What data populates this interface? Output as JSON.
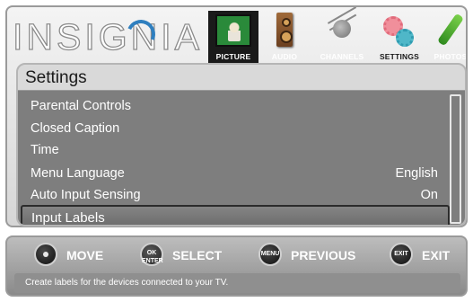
{
  "brand": {
    "logo_text": "INSIGNIA"
  },
  "tabs": [
    {
      "label": "PICTURE",
      "icon": "tv-icon"
    },
    {
      "label": "AUDIO",
      "icon": "speaker-icon"
    },
    {
      "label": "CHANNELS",
      "icon": "antenna-icon"
    },
    {
      "label": "SETTINGS",
      "icon": "gears-icon",
      "active": true
    },
    {
      "label": "PHOTOS",
      "icon": "photo-icon"
    }
  ],
  "settings": {
    "title": "Settings",
    "items": [
      {
        "label": "Parental Controls",
        "value": ""
      },
      {
        "label": "Closed Caption",
        "value": ""
      },
      {
        "label": "Time",
        "value": ""
      },
      {
        "label": "Menu Language",
        "value": "English"
      },
      {
        "label": "Auto Input Sensing",
        "value": "On"
      },
      {
        "label": "Input Labels",
        "value": "",
        "selected": true
      }
    ]
  },
  "help": {
    "move": {
      "button": "",
      "label": "MOVE"
    },
    "select": {
      "button": "OK ENTER",
      "label": "SELECT"
    },
    "previous": {
      "button": "MENU",
      "label": "PREVIOUS"
    },
    "exit": {
      "button": "EXIT",
      "label": "EXIT"
    },
    "description": "Create labels for the devices connected to your TV."
  }
}
